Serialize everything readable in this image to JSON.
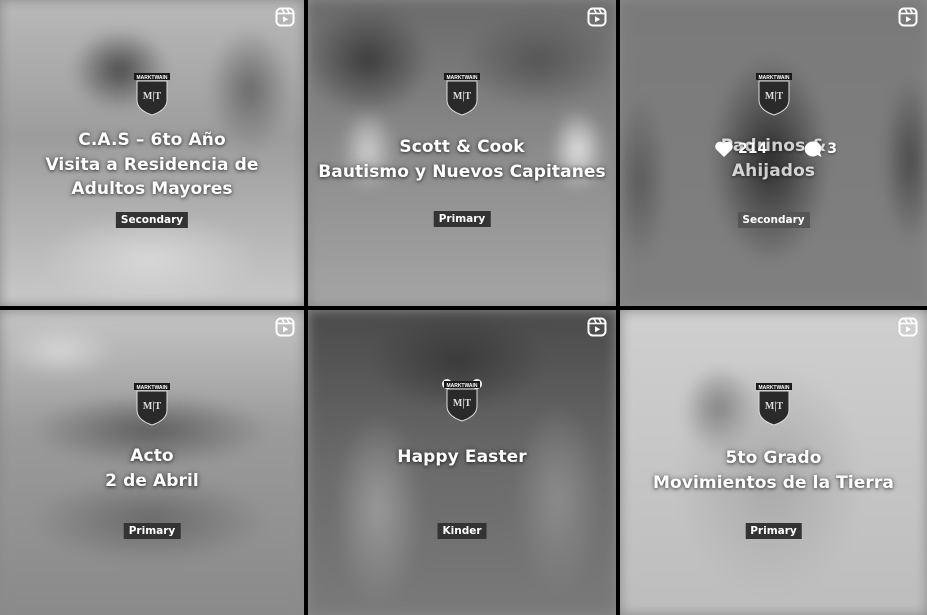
{
  "tiles": [
    {
      "title_lines": [
        "C.A.S – 6to Año",
        "Visita a Residencia de",
        "Adultos Mayores"
      ],
      "badge": "Secondary",
      "logo_text": "MARKTWAIN"
    },
    {
      "title_lines": [
        "Scott & Cook",
        "Bautismo y Nuevos Capitanes"
      ],
      "badge": "Primary",
      "logo_text": "MARKTWAIN"
    },
    {
      "title_lines": [
        "Padrinos &",
        "Ahijados"
      ],
      "badge": "Secondary",
      "logo_text": "MARKTWAIN",
      "stats": {
        "likes": "214",
        "comments": "3"
      }
    },
    {
      "title_lines": [
        "Acto",
        "2 de Abril"
      ],
      "badge": "Primary",
      "logo_text": "MARKTWAIN"
    },
    {
      "title_lines": [
        "Happy Easter"
      ],
      "badge": "Kinder",
      "logo_text": "MARKTWAIN"
    },
    {
      "title_lines": [
        "5to Grado",
        "Movimientos de la Tierra"
      ],
      "badge": "Primary",
      "logo_text": "MARKTWAIN"
    }
  ],
  "icons": {
    "reel": "reels-icon",
    "like": "heart-icon",
    "comment": "comment-icon",
    "logo": "school-crest-logo"
  }
}
